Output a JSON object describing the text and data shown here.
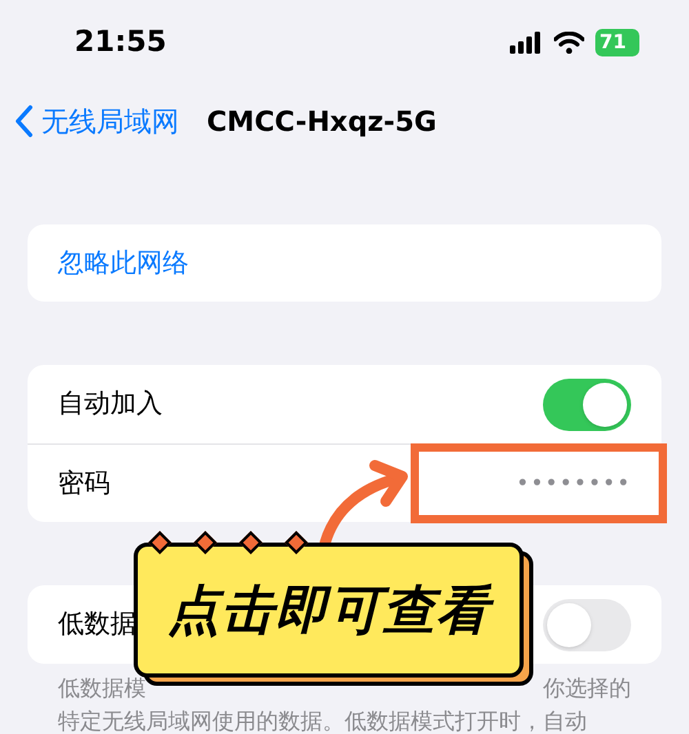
{
  "status_bar": {
    "time": "21:55",
    "battery": "71"
  },
  "nav": {
    "back_label": "无线局域网",
    "title": "CMCC-Hxqz-5G"
  },
  "forget_button": "忽略此网络",
  "settings": [
    {
      "kind": "toggle",
      "label": "自动加入",
      "on": true
    },
    {
      "kind": "password",
      "label": "密码",
      "value": "••••••••"
    }
  ],
  "low_data": {
    "label": "低数据",
    "on": false
  },
  "footer": {
    "line_1_start": "低数据模",
    "line_1_end": "你选择的",
    "line_2": "特定无线局域网使用的数据。低数据模式打开时，自动"
  },
  "callout": {
    "text": "点击即可查看"
  }
}
